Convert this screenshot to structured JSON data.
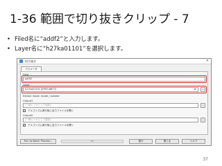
{
  "slide": {
    "title": "1-36  範囲で切り抜きクリップ - 7",
    "bullets": [
      "Filed名に“addf2”と入力します。",
      "Layer名に“h27ka01101”を選択します。"
    ],
    "page_number": "37"
  },
  "dialog": {
    "title": "切り抜き",
    "close_glyph": "✕",
    "tab_label": "パラメータ",
    "fields": {
      "field_label": "Field",
      "field_value": "addf2",
      "layer_label": "Layer",
      "layer_value": "h27ka01101 [EPSG:6677]",
      "option_label": "Extract mode: inside / outside",
      "output1_label": "Output1",
      "output1_placeholder": "[一時レイヤとして保存]",
      "output1_checkbox_label": "アルゴリズム実行後に出力ファイルを開く",
      "output2_label": "Output2",
      "output2_placeholder": "[一時レイヤとして保存]",
      "output2_checkbox_label": "アルゴリズム実行後に出力ファイルを開く",
      "browse_glyph": "…"
    },
    "footer": {
      "batch_button": "Run as Batch Process...",
      "progress_text": "0%",
      "run_button": "実行",
      "close_button": "閉じる",
      "help_button": "ヘルプ"
    }
  },
  "colors": {
    "highlight": "#d3282c",
    "dialog_bg": "#f0f0f0",
    "title_text": "#1a1a1a"
  },
  "icons": {
    "combo_arrow": "chevron-down-icon",
    "checkbox": "check-icon"
  }
}
